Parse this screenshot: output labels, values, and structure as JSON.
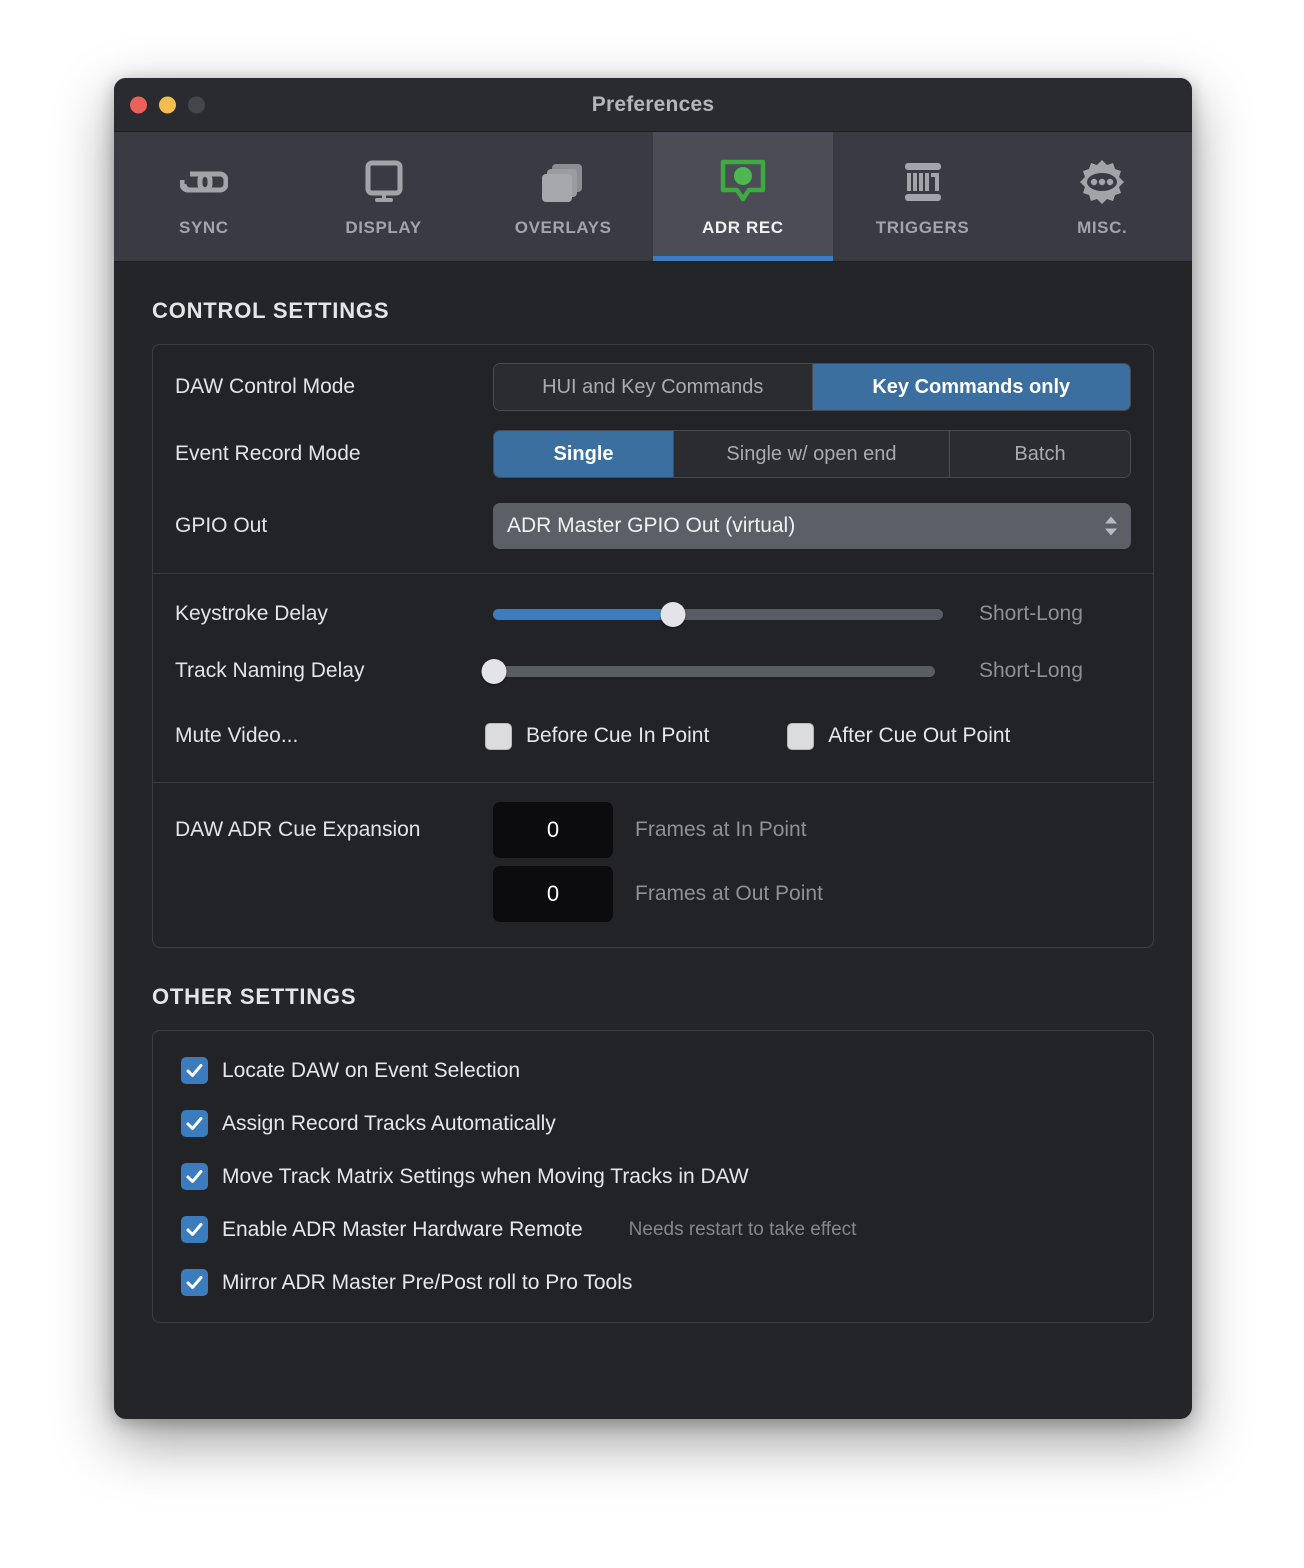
{
  "window": {
    "title": "Preferences",
    "traffic_lights": [
      "close-button",
      "minimize-button",
      "zoom-button"
    ]
  },
  "toolbar": {
    "tabs": [
      {
        "label": "SYNC",
        "icon": "link-icon",
        "active": false
      },
      {
        "label": "DISPLAY",
        "icon": "monitor-icon",
        "active": false
      },
      {
        "label": "OVERLAYS",
        "icon": "layers-icon",
        "active": false
      },
      {
        "label": "ADR REC",
        "icon": "record-bubble-icon",
        "active": true
      },
      {
        "label": "TRIGGERS",
        "icon": "midi-icon",
        "active": false
      },
      {
        "label": "MISC.",
        "icon": "gear-icon",
        "active": false
      }
    ]
  },
  "control_settings": {
    "heading": "CONTROL SETTINGS",
    "daw_control_mode": {
      "label": "DAW Control Mode",
      "options": [
        "HUI and Key Commands",
        "Key Commands only"
      ],
      "selected": "Key Commands only"
    },
    "event_record_mode": {
      "label": "Event Record Mode",
      "options": [
        "Single",
        "Single w/ open end",
        "Batch"
      ],
      "selected": "Single"
    },
    "gpio_out": {
      "label": "GPIO Out",
      "value": "ADR Master GPIO Out (virtual)"
    },
    "keystroke_delay": {
      "label": "Keystroke Delay",
      "caption": "Short-Long",
      "percent": 40
    },
    "track_naming_delay": {
      "label": "Track Naming Delay",
      "caption": "Short-Long",
      "percent": 1
    },
    "mute_video": {
      "label": "Mute Video...",
      "options": [
        {
          "label": "Before Cue In Point",
          "checked": false
        },
        {
          "label": "After Cue Out Point",
          "checked": false
        }
      ]
    },
    "cue_expansion": {
      "label": "DAW ADR Cue Expansion",
      "fields": [
        {
          "value": "0",
          "caption": "Frames at In Point"
        },
        {
          "value": "0",
          "caption": "Frames at Out Point"
        }
      ]
    }
  },
  "other_settings": {
    "heading": "OTHER SETTINGS",
    "items": [
      {
        "label": "Locate DAW on Event Selection",
        "checked": true,
        "note": ""
      },
      {
        "label": "Assign Record Tracks Automatically",
        "checked": true,
        "note": ""
      },
      {
        "label": "Move Track Matrix Settings when Moving Tracks in DAW",
        "checked": true,
        "note": ""
      },
      {
        "label": "Enable ADR Master Hardware Remote",
        "checked": true,
        "note": "Needs restart to take effect"
      },
      {
        "label": "Mirror ADR Master Pre/Post roll to Pro Tools",
        "checked": true,
        "note": ""
      }
    ]
  },
  "colors": {
    "accent_blue": "#3d7cc0",
    "segment_selected": "#3a6f9f",
    "record_green": "#3faa42",
    "window_bg": "#242529",
    "toolbar_bg": "#3a3b42",
    "close": "#eb6157",
    "minimize": "#f5bd4f",
    "zoom_disabled": "#45464b"
  }
}
